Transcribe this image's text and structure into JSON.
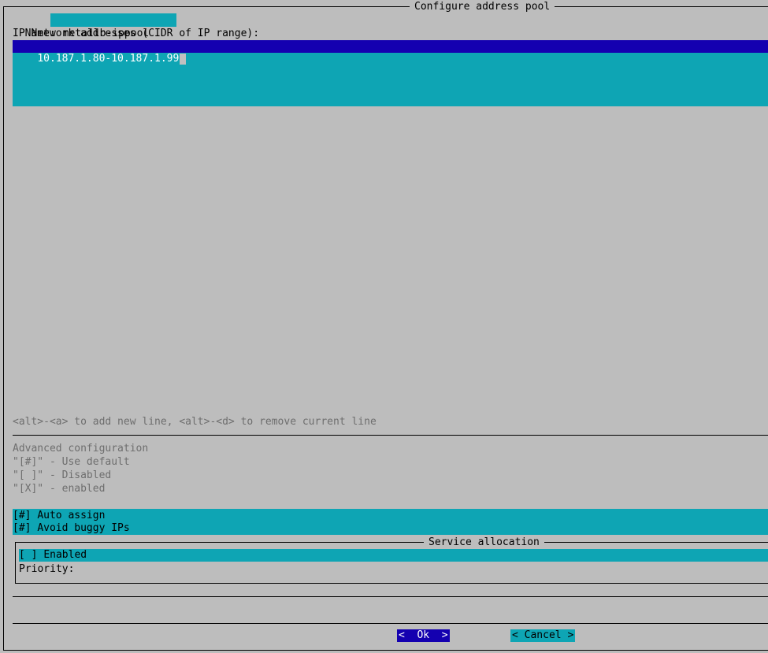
{
  "dialog": {
    "title": "Configure address pool"
  },
  "name_field": {
    "label": "Name:",
    "value": "metallb-ippool"
  },
  "addresses": {
    "label": "IP Network addresses (CIDR of IP range):",
    "lines": [
      "10.187.1.80-10.187.1.99"
    ],
    "hint": "<alt>-<a> to add new line, <alt>-<d> to remove current line"
  },
  "advanced": {
    "heading": "Advanced configuration",
    "legend": [
      "\"[#]\" - Use default",
      "\"[ ]\" - Disabled",
      "\"[X]\" - enabled"
    ],
    "options": [
      {
        "mark": "[#]",
        "label": "Auto assign"
      },
      {
        "mark": "[#]",
        "label": "Avoid buggy IPs"
      }
    ]
  },
  "service_allocation": {
    "title": "Service allocation",
    "enabled_mark": "[ ]",
    "enabled_label": "Enabled",
    "priority_label": "Priority:",
    "priority_value": ""
  },
  "buttons": {
    "ok_label": "<  Ok  >",
    "cancel_label": "< Cancel >"
  },
  "colors": {
    "background": "#bdbdbd",
    "field": "#0ea5b4",
    "selected": "#1400b0"
  }
}
